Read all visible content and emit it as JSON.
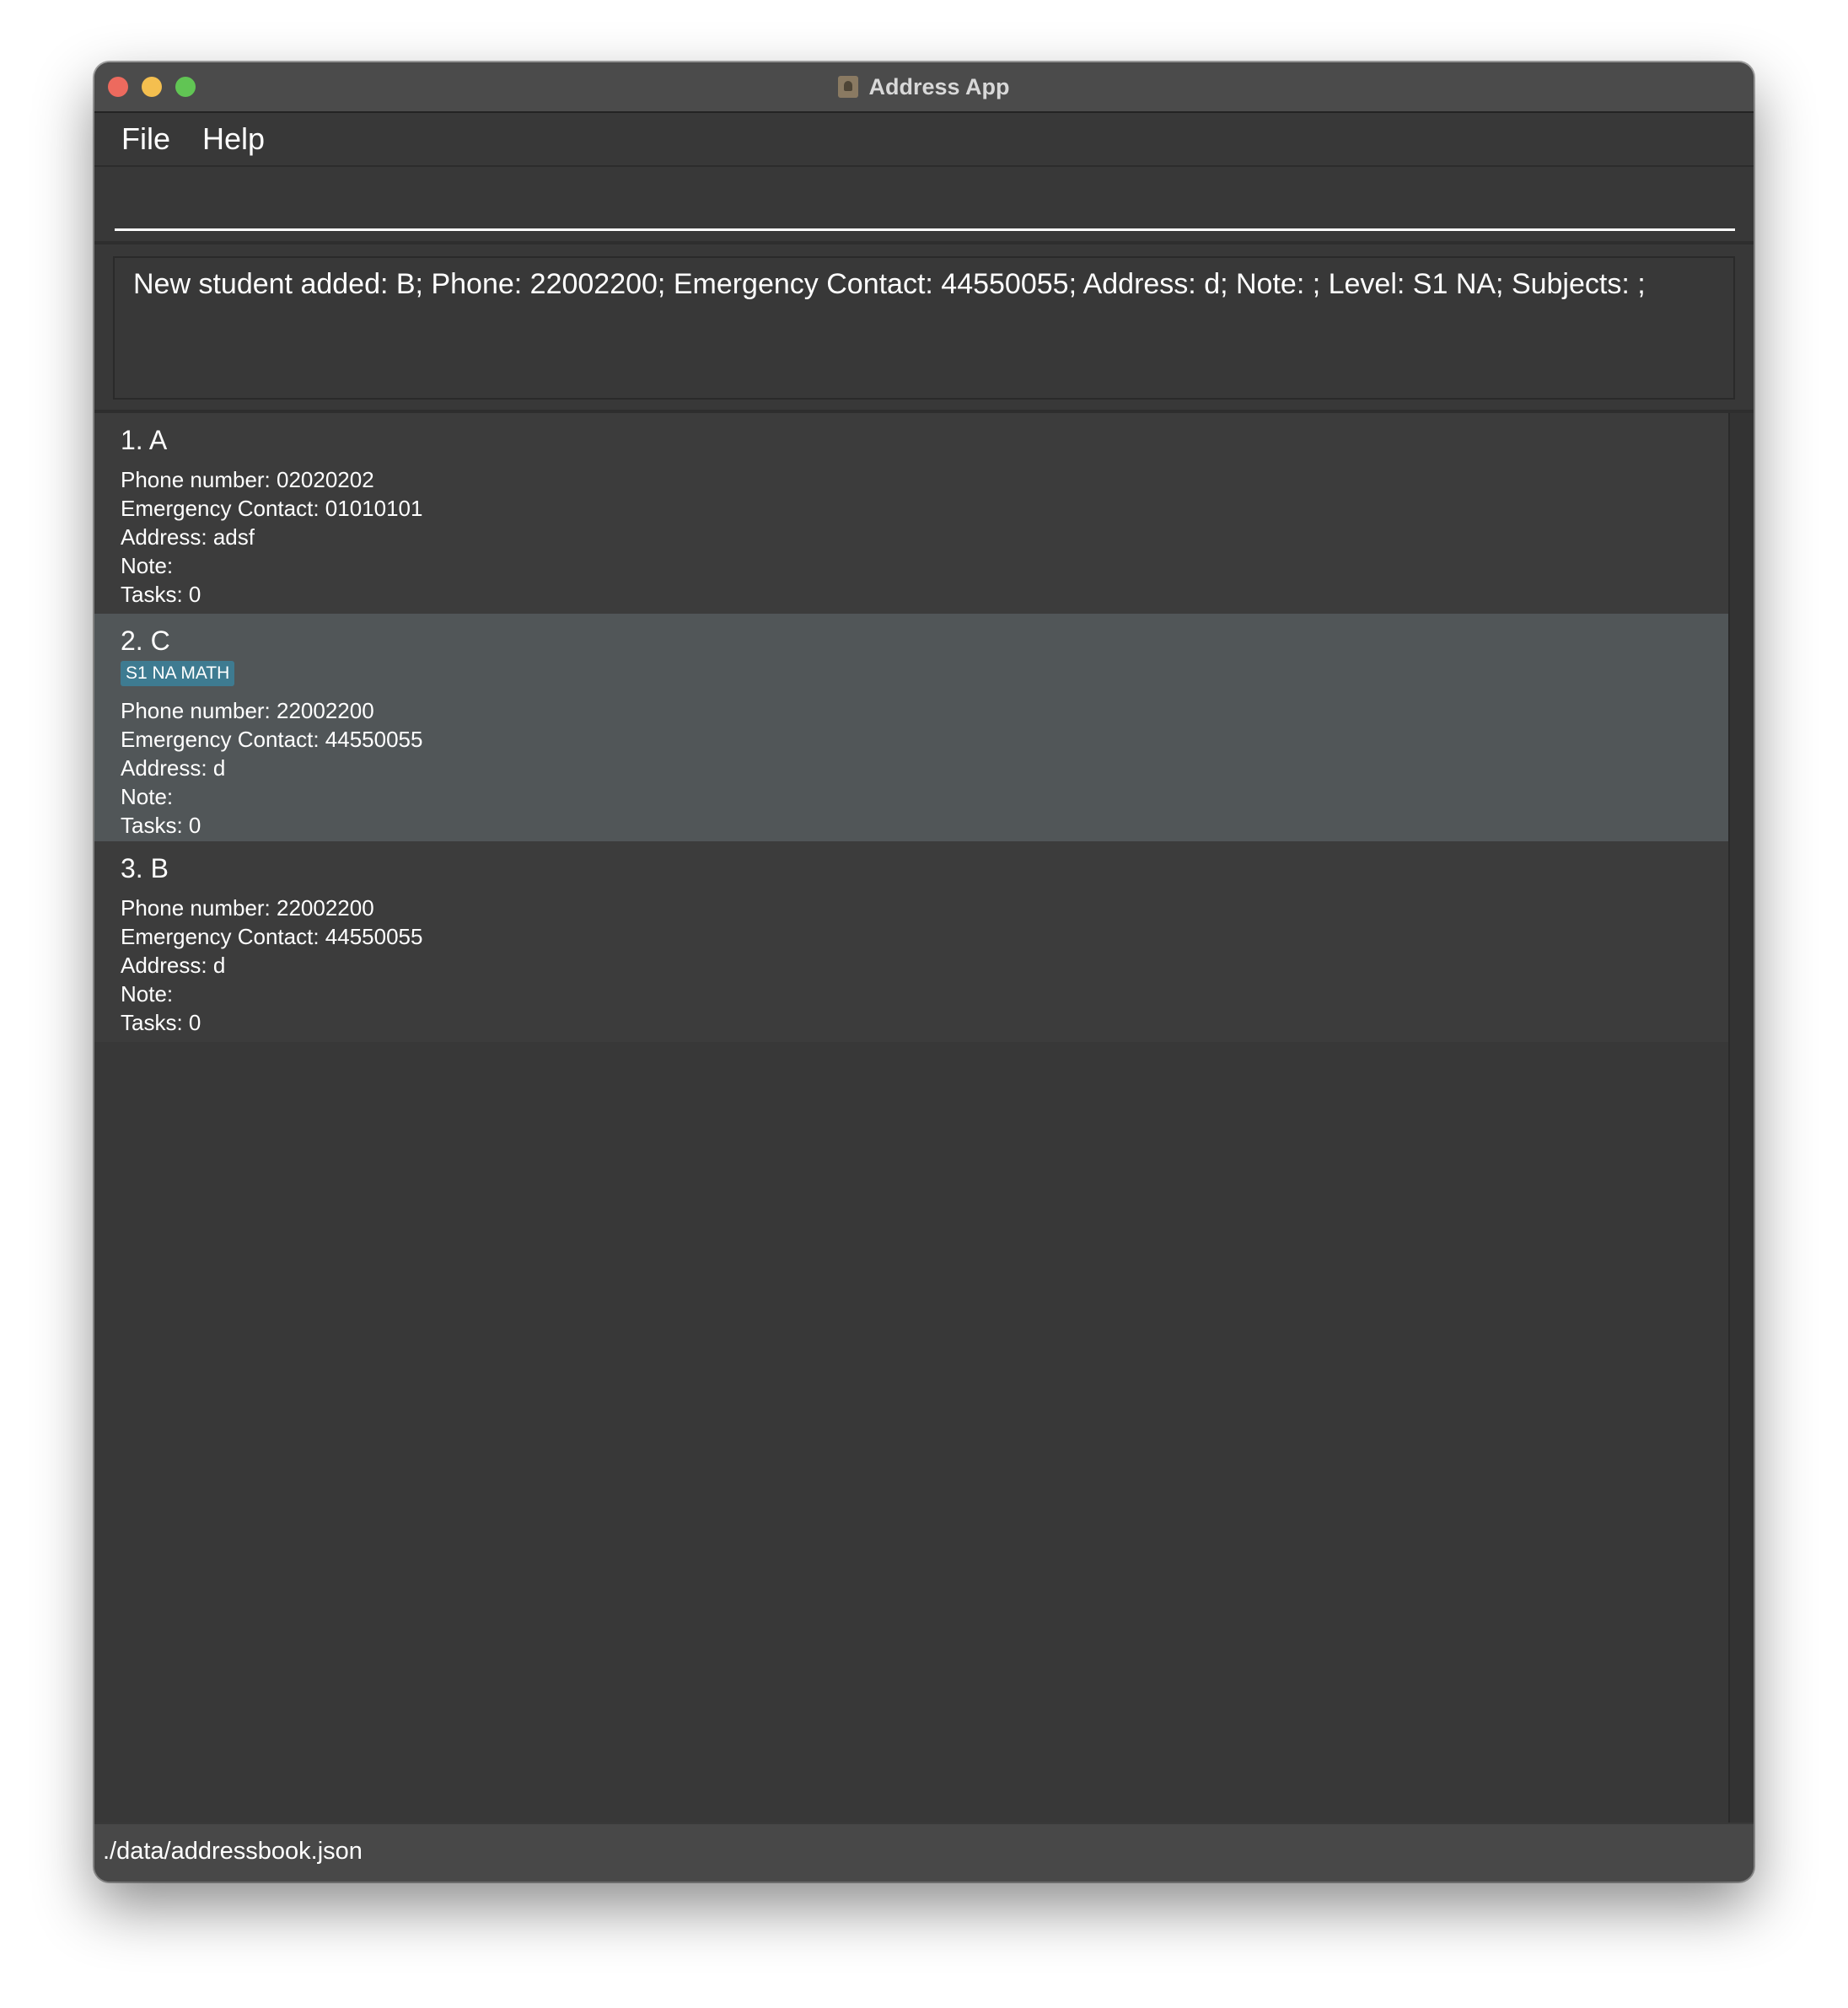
{
  "window": {
    "title": "Address App"
  },
  "menu": {
    "file": "File",
    "help": "Help"
  },
  "command": {
    "value": "",
    "placeholder": ""
  },
  "result": {
    "message": "New student added: B; Phone: 22002200; Emergency Contact: 44550055; Address: d; Note: ; Level: S1 NA; Subjects: ;"
  },
  "students": [
    {
      "heading": "1. A",
      "phone": "Phone number: 02020202",
      "emergency": "Emergency Contact: 01010101",
      "address": "Address: adsf",
      "note": "Note:",
      "tasks": "Tasks: 0"
    },
    {
      "heading": "2. C",
      "tag": "S1 NA MATH",
      "phone": "Phone number: 22002200",
      "emergency": "Emergency Contact: 44550055",
      "address": "Address: d",
      "note": "Note:",
      "tasks": "Tasks: 0"
    },
    {
      "heading": "3. B",
      "phone": "Phone number: 22002200",
      "emergency": "Emergency Contact: 44550055",
      "address": "Address: d",
      "note": "Note:",
      "tasks": "Tasks: 0"
    }
  ],
  "status": {
    "file_path": "./data/addressbook.json"
  },
  "colors": {
    "window_bg": "#383838",
    "selected_card": "#515658",
    "tag_bg": "#3e7b91"
  }
}
